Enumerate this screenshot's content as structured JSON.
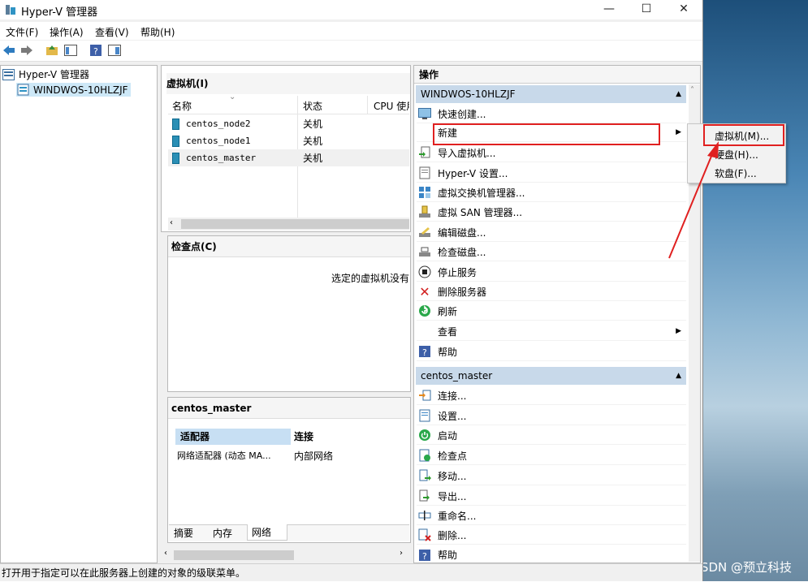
{
  "window": {
    "title": "Hyper-V 管理器"
  },
  "menu": {
    "file": "文件(F)",
    "action": "操作(A)",
    "view": "查看(V)",
    "help": "帮助(H)"
  },
  "tree": {
    "root": "Hyper-V 管理器",
    "server": "WINDWOS-10HLZJF"
  },
  "vm_panel": {
    "title": "虚拟机(I)",
    "columns": {
      "name": "名称",
      "state": "状态",
      "cpu": "CPU 使用"
    },
    "rows": [
      {
        "name": "centos_node2",
        "state": "关机"
      },
      {
        "name": "centos_node1",
        "state": "关机"
      },
      {
        "name": "centos_master",
        "state": "关机"
      }
    ]
  },
  "checkpoint_panel": {
    "title": "检查点(C)",
    "empty_text": "选定的虚拟机没有"
  },
  "details_panel": {
    "title": "centos_master",
    "col_adapter": "适配器",
    "col_connection": "连接",
    "adapter_value": "网络适配器 (动态 MA...",
    "connection_value": "内部网络",
    "tabs": [
      "摘要",
      "内存",
      "网络"
    ]
  },
  "actions": {
    "title": "操作",
    "server_section": "WINDWOS-10HLZJF",
    "server_items": [
      "快速创建...",
      "新建",
      "导入虚拟机...",
      "Hyper-V 设置...",
      "虚拟交换机管理器...",
      "虚拟 SAN 管理器...",
      "编辑磁盘...",
      "检查磁盘...",
      "停止服务",
      "删除服务器",
      "刷新",
      "查看",
      "帮助"
    ],
    "vm_section": "centos_master",
    "vm_items": [
      "连接...",
      "设置...",
      "启动",
      "检查点",
      "移动...",
      "导出...",
      "重命名...",
      "删除...",
      "帮助"
    ]
  },
  "submenu": {
    "items": [
      "虚拟机(M)...",
      "硬盘(H)...",
      "软盘(F)..."
    ]
  },
  "status": {
    "text": "打开用于指定可以在此服务器上创建的对象的级联菜单。"
  },
  "watermark": "CSDN @预立科技",
  "colors": {
    "highlight_red": "#e02020",
    "section_blue": "#c8d9ea",
    "selected_row": "#f0f0f0"
  }
}
